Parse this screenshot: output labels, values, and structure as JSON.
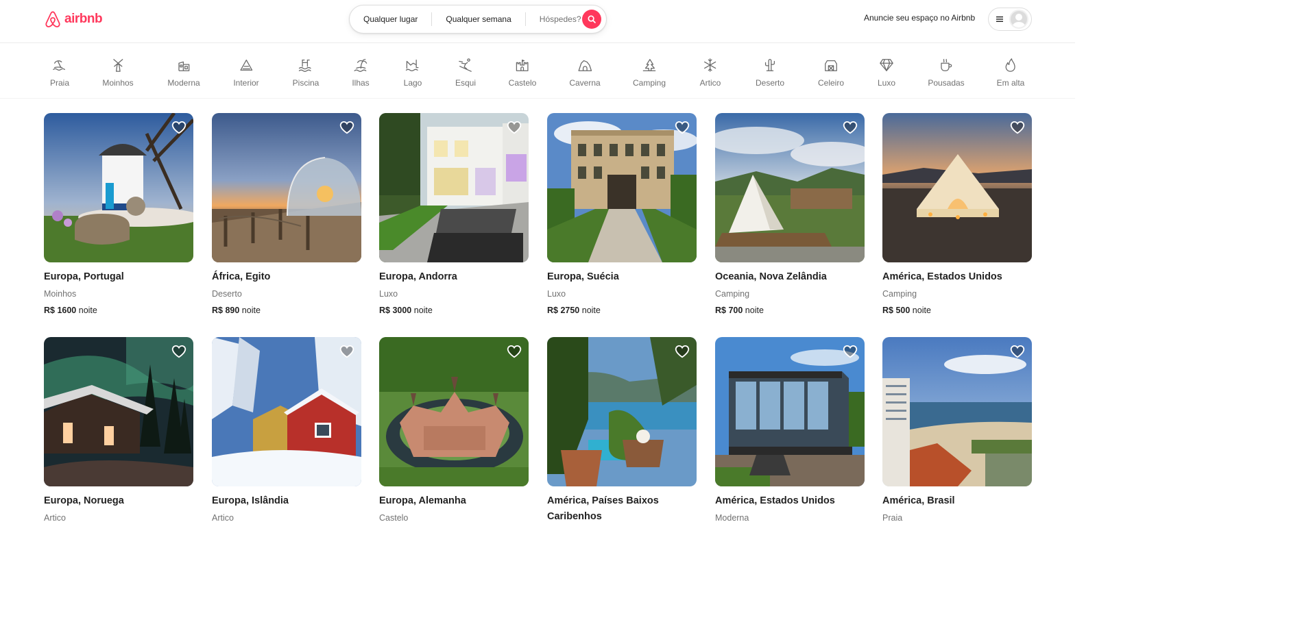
{
  "brand": {
    "name": "airbnb",
    "color": "#ff385c"
  },
  "search": {
    "location": "Qualquer lugar",
    "week": "Qualquer semana",
    "guests": "Hóspedes?"
  },
  "header": {
    "host_link": "Anuncie seu espaço no Airbnb"
  },
  "categories": [
    {
      "label": "Praia",
      "icon": "beach-icon"
    },
    {
      "label": "Moinhos",
      "icon": "windmill-icon"
    },
    {
      "label": "Moderna",
      "icon": "modern-house-icon"
    },
    {
      "label": "Interior",
      "icon": "countryside-icon"
    },
    {
      "label": "Piscina",
      "icon": "pool-icon"
    },
    {
      "label": "Ilhas",
      "icon": "island-icon"
    },
    {
      "label": "Lago",
      "icon": "lake-icon"
    },
    {
      "label": "Esqui",
      "icon": "ski-icon"
    },
    {
      "label": "Castelo",
      "icon": "castle-icon"
    },
    {
      "label": "Caverna",
      "icon": "cave-icon"
    },
    {
      "label": "Camping",
      "icon": "camping-icon"
    },
    {
      "label": "Artico",
      "icon": "snowflake-icon"
    },
    {
      "label": "Deserto",
      "icon": "cactus-icon"
    },
    {
      "label": "Celeiro",
      "icon": "barn-icon"
    },
    {
      "label": "Luxo",
      "icon": "diamond-icon"
    },
    {
      "label": "Pousadas",
      "icon": "coffee-cup-icon"
    },
    {
      "label": "Em alta",
      "icon": "flame-icon"
    }
  ],
  "listings": [
    {
      "title": "Europa, Portugal",
      "category": "Moinhos",
      "price": "R$ 1600",
      "unit": "noite"
    },
    {
      "title": "África, Egito",
      "category": "Deserto",
      "price": "R$ 890",
      "unit": "noite"
    },
    {
      "title": "Europa, Andorra",
      "category": "Luxo",
      "price": "R$ 3000",
      "unit": "noite"
    },
    {
      "title": "Europa, Suécia",
      "category": "Luxo",
      "price": "R$ 2750",
      "unit": "noite"
    },
    {
      "title": "Oceania, Nova Zelândia",
      "category": "Camping",
      "price": "R$ 700",
      "unit": "noite"
    },
    {
      "title": "América, Estados Unidos",
      "category": "Camping",
      "price": "R$ 500",
      "unit": "noite"
    },
    {
      "title": "Europa, Noruega",
      "category": "Artico"
    },
    {
      "title": "Europa, Islândia",
      "category": "Artico"
    },
    {
      "title": "Europa, Alemanha",
      "category": "Castelo"
    },
    {
      "title": "América, Países Baixos Caribenhos"
    },
    {
      "title": "América, Estados Unidos",
      "category": "Moderna"
    },
    {
      "title": "América, Brasil",
      "category": "Praia"
    }
  ]
}
